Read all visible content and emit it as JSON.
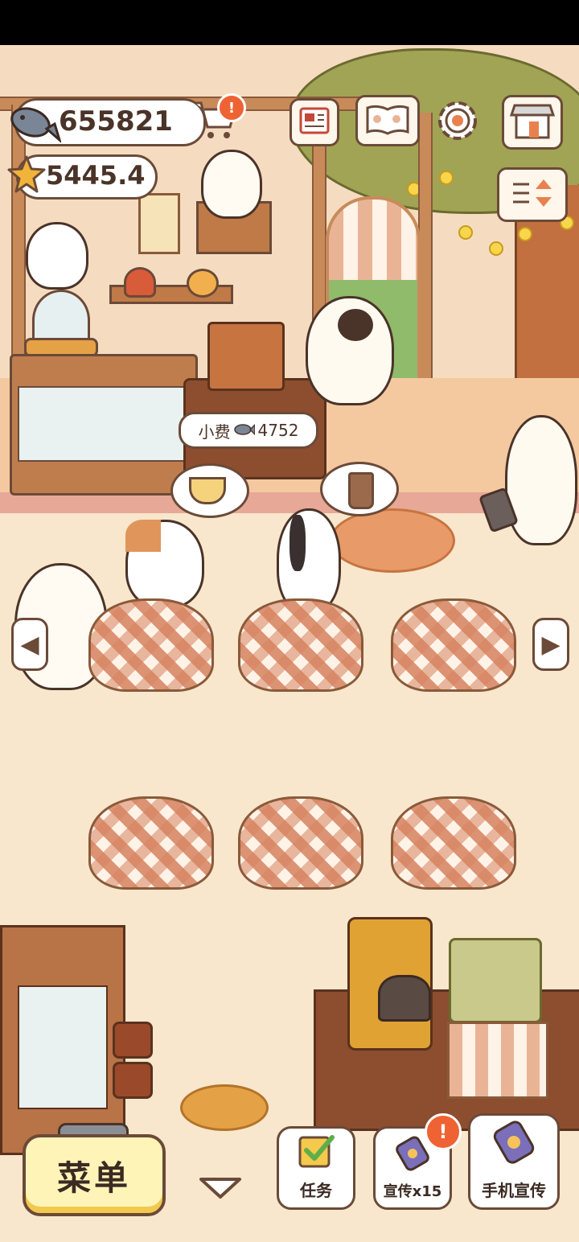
{
  "currency": {
    "fish_amount": "655821",
    "star_amount": "5445.4"
  },
  "tip_bubble": {
    "label": "小费",
    "amount": "4752"
  },
  "bottom_bar": {
    "menu_label": "菜单",
    "task_label": "任务",
    "promote_label": "宣传x15",
    "phone_promote_label": "手机宣传"
  },
  "notifications": {
    "cart_alert": "!",
    "promote_alert": "!"
  },
  "colors": {
    "accent": "#ef6234",
    "outline": "#6b4a38",
    "cream": "#f8e7cd"
  },
  "icons": [
    "fish-icon",
    "star-icon",
    "cart-icon",
    "newspaper-icon",
    "paw-book-icon",
    "gear-icon",
    "shop-icon",
    "layout-toggle-icon",
    "arrow-left-icon",
    "arrow-right-icon",
    "checkbox-icon",
    "phone-icon",
    "chevron-down-icon"
  ]
}
